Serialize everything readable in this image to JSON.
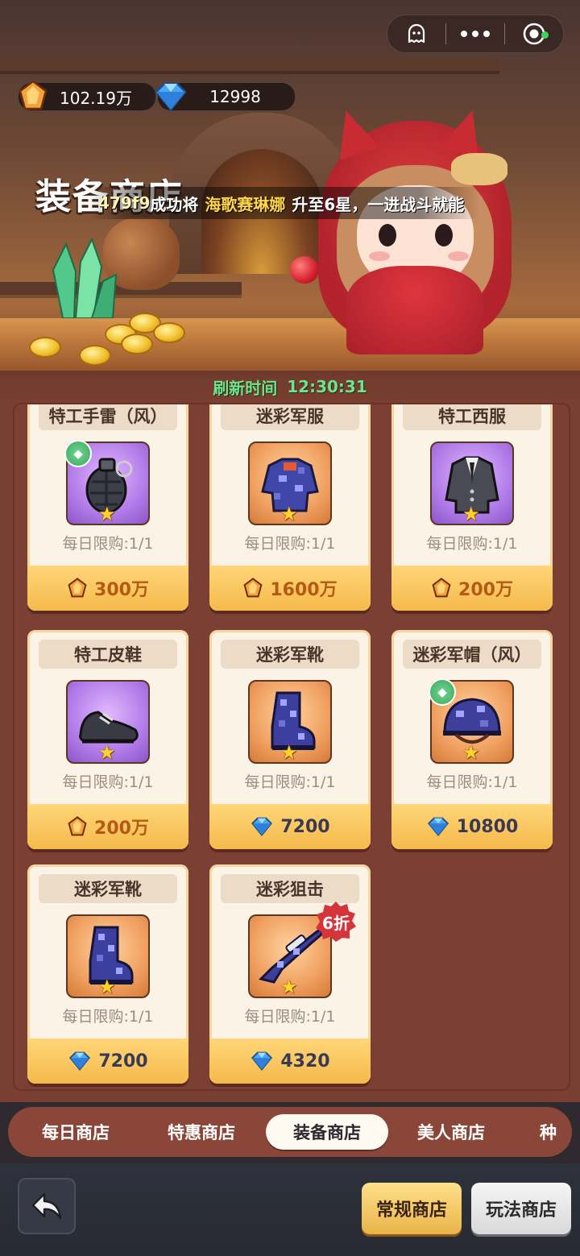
{
  "currency": {
    "gold": "102.19万",
    "gems": "12998"
  },
  "shop_title": "装备商店",
  "notice": {
    "player": "479f9",
    "text_1": "成功将",
    "hero": "海歌赛琳娜",
    "text_2": "升至6星，一进战斗就能"
  },
  "refresh": {
    "label": "刷新时间",
    "time": "12:30:31"
  },
  "items": [
    {
      "name": "特工手雷（风）",
      "limit": "每日限购:1/1",
      "price": "300万",
      "currency": "gold",
      "bg": "purple",
      "icon": "grenade-icon",
      "wind_badge": true
    },
    {
      "name": "迷彩军服",
      "limit": "每日限购:1/1",
      "price": "1600万",
      "currency": "gold",
      "bg": "orange",
      "icon": "camo-uniform-icon"
    },
    {
      "name": "特工西服",
      "limit": "每日限购:1/1",
      "price": "200万",
      "currency": "gold",
      "bg": "purple",
      "icon": "suit-icon"
    },
    {
      "name": "特工皮鞋",
      "limit": "每日限购:1/1",
      "price": "200万",
      "currency": "gold",
      "bg": "purple",
      "icon": "leather-shoe-icon"
    },
    {
      "name": "迷彩军靴",
      "limit": "每日限购:1/1",
      "price": "7200",
      "currency": "gem",
      "bg": "orange",
      "icon": "camo-boot-icon"
    },
    {
      "name": "迷彩军帽（风）",
      "limit": "每日限购:1/1",
      "price": "10800",
      "currency": "gem",
      "bg": "orange",
      "icon": "camo-helmet-icon",
      "wind_badge": true
    },
    {
      "name": "迷彩军靴",
      "limit": "每日限购:1/1",
      "price": "7200",
      "currency": "gem",
      "bg": "orange",
      "icon": "camo-boot-icon"
    },
    {
      "name": "迷彩狙击",
      "limit": "每日限购:1/1",
      "price": "4320",
      "currency": "gem",
      "bg": "orange",
      "icon": "sniper-rifle-icon",
      "discount": "6折"
    }
  ],
  "tabs": [
    "每日商店",
    "特惠商店",
    "装备商店",
    "美人商店",
    "种"
  ],
  "active_tab": "装备商店",
  "bottom": {
    "regular_shop": "常规商店",
    "play_shop": "玩法商店"
  },
  "colors": {
    "price_gold": "#b55a14",
    "refresh_green": "#6fe38b",
    "panel": "#7b3f34"
  }
}
